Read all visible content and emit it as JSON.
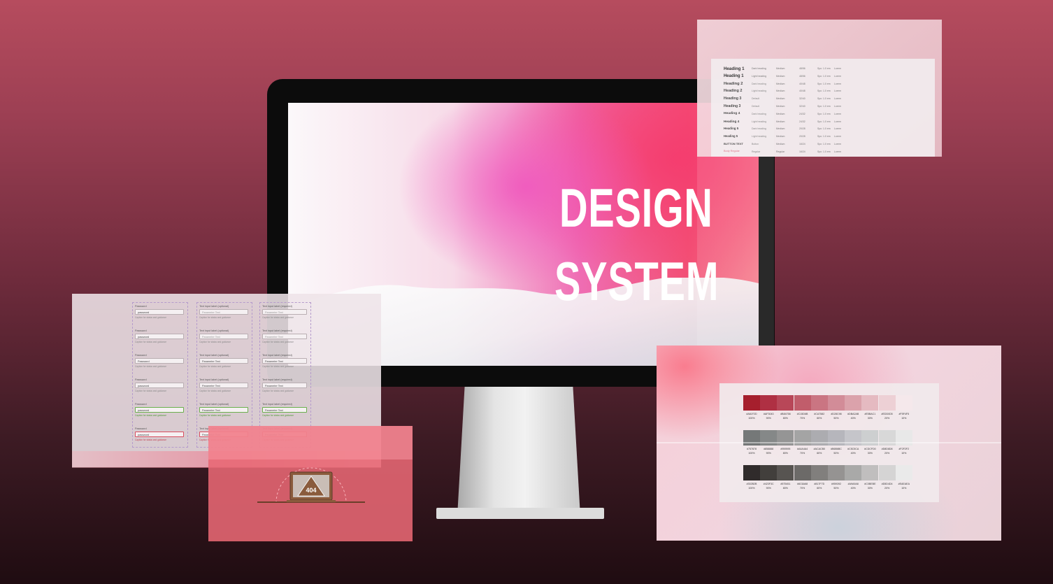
{
  "hero": {
    "title_line1": "DESIGN",
    "title_line2": "SYSTEM"
  },
  "colors": {
    "background_top": "#b64c5e",
    "background_bottom": "#1f0c11",
    "accent_pink": "#ef6db3",
    "accent_coral": "#f25276"
  },
  "typography_panel": {
    "rows": [
      {
        "name": "Heading 1",
        "role": "Dark heading",
        "weight": "Medium",
        "size": "48/56",
        "line": "Spc: 1.0 em",
        "use": "Lorem"
      },
      {
        "name": "Heading 1",
        "role": "Light heading",
        "weight": "Medium",
        "size": "48/56",
        "line": "Spc: 1.0 em",
        "use": "Lorem"
      },
      {
        "name": "Heading 2",
        "role": "Dark heading",
        "weight": "Medium",
        "size": "40/48",
        "line": "Spc: 1.0 em",
        "use": "Lorem"
      },
      {
        "name": "Heading 2",
        "role": "Light heading",
        "weight": "Medium",
        "size": "40/48",
        "line": "Spc: 1.0 em",
        "use": "Lorem"
      },
      {
        "name": "Heading 3",
        "role": "Default",
        "weight": "Medium",
        "size": "32/40",
        "line": "Spc: 1.0 em",
        "use": "Lorem"
      },
      {
        "name": "Heading 3",
        "role": "Default",
        "weight": "Medium",
        "size": "32/40",
        "line": "Spc: 1.0 em",
        "use": "Lorem"
      },
      {
        "name": "Heading 4",
        "role": "Dark heading",
        "weight": "Medium",
        "size": "24/32",
        "line": "Spc: 1.0 em",
        "use": "Lorem"
      },
      {
        "name": "Heading 4",
        "role": "Light heading",
        "weight": "Medium",
        "size": "24/32",
        "line": "Spc: 1.0 em",
        "use": "Lorem"
      },
      {
        "name": "Heading 5",
        "role": "Dark heading",
        "weight": "Medium",
        "size": "20/28",
        "line": "Spc: 1.0 em",
        "use": "Lorem"
      },
      {
        "name": "Heading 5",
        "role": "Light heading",
        "weight": "Medium",
        "size": "20/28",
        "line": "Spc: 1.0 em",
        "use": "Lorem"
      },
      {
        "name": "BUTTON TEXT",
        "role": "Button",
        "weight": "Medium",
        "size": "16/24",
        "line": "Spc: 1.0 em",
        "use": "Lorem"
      },
      {
        "name": "Body Regular",
        "role": "Regular",
        "weight": "Regular",
        "size": "16/24",
        "line": "Spc: 1.0 em",
        "use": "Lorem"
      }
    ]
  },
  "forms_panel": {
    "password_label": "Password",
    "password_value": "password",
    "password_placeholder": "Password",
    "placeholder_text": "Parameter Text",
    "help_text": "Caption for status and guidance",
    "field_label": "Text input label (optional)",
    "select_label": "Text input label (required)",
    "success_msg": "Caption for status and guidance",
    "error_msg": "Caption for status and guidance"
  },
  "error_panel": {
    "code": "404"
  },
  "color_panel": {
    "rows": [
      {
        "codes": [
          "#A61F2D",
          "#AF3043",
          "#B84758",
          "#C15D6B",
          "#CA7582",
          "#D28C98",
          "#DBA2AB",
          "#E5BAC1",
          "#EDD0D5",
          "#F5F4F5"
        ],
        "hex": [
          "#a61f2d",
          "#af3043",
          "#b84758",
          "#c15d6b",
          "#ca7582",
          "#d28c98",
          "#dba2ab",
          "#e5bac1",
          "#edd0d5",
          "#f5e8eb"
        ]
      },
      {
        "codes": [
          "#757878",
          "#858888",
          "#959595",
          "#A4A4A4",
          "#ACACB0",
          "#B6B6BC",
          "#C5C5CA",
          "#CDCFD0",
          "#D8D8D8",
          "#F2F2F2"
        ],
        "hex": [
          "#757878",
          "#858888",
          "#959595",
          "#a4a4a4",
          "#acacb0",
          "#b6b6bc",
          "#c5c5ca",
          "#cdcfd0",
          "#d8d8d8",
          "#e8e8e8"
        ]
      },
      {
        "codes": [
          "#302B2B",
          "#423F3C",
          "#575451",
          "#6C6A68",
          "#817F7D",
          "#959392",
          "#A9A9A8",
          "#C0BEBE",
          "#D5D4D4",
          "#EAEAEA"
        ],
        "hex": [
          "#302b2b",
          "#423f3c",
          "#575451",
          "#6c6a68",
          "#817f7d",
          "#959392",
          "#a9a9a8",
          "#c0bebe",
          "#d5d4d4",
          "#eaeaea"
        ]
      }
    ],
    "percents": [
      "100%",
      "90%",
      "80%",
      "70%",
      "60%",
      "50%",
      "40%",
      "30%",
      "20%",
      "10%"
    ]
  }
}
